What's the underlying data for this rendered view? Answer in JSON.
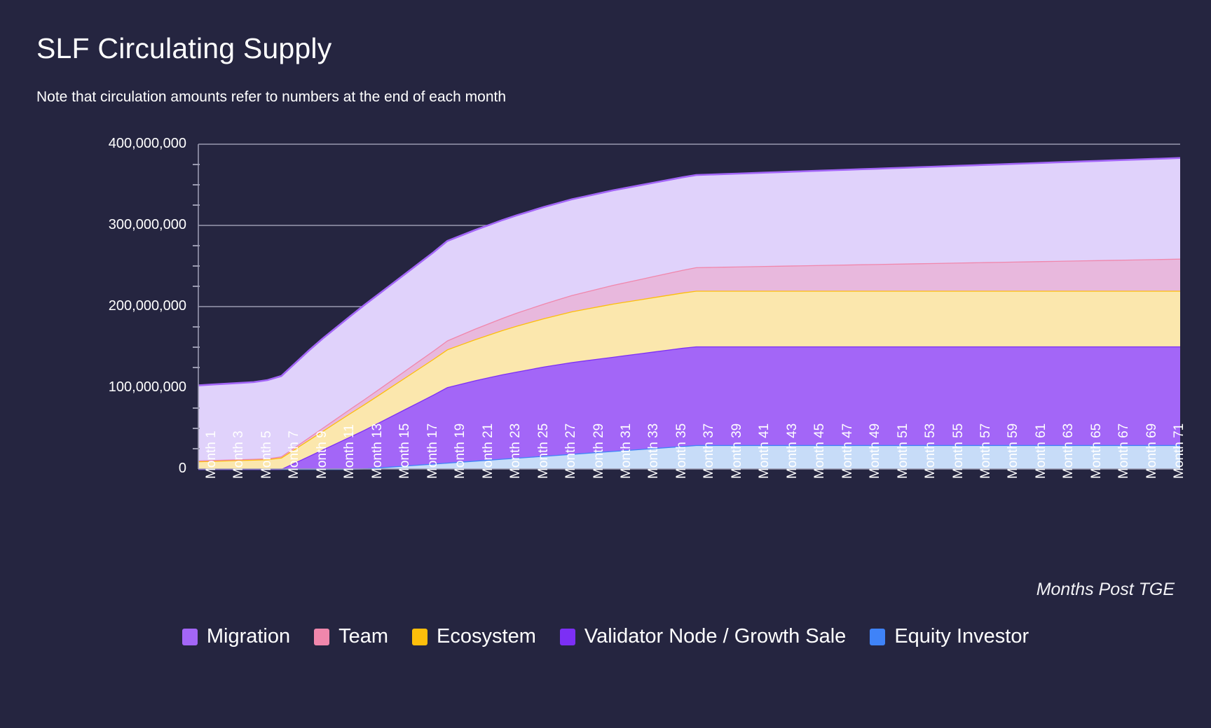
{
  "header": {
    "title": "SLF Circulating Supply",
    "subtitle": "Note that circulation amounts refer to numbers at the end of each month"
  },
  "axis": {
    "x_title": "Months Post TGE"
  },
  "legend": {
    "items": [
      {
        "label": "Migration",
        "color": "#a366f7"
      },
      {
        "label": "Team",
        "color": "#f087ac"
      },
      {
        "label": "Ecosystem",
        "color": "#fdbe0b"
      },
      {
        "label": "Validator Node / Growth Sale",
        "color": "#7c2ff5"
      },
      {
        "label": "Equity Investor",
        "color": "#3f83f8"
      }
    ]
  },
  "colors": {
    "background": "#252540",
    "grid": "#9a9ab0",
    "axis": "#9a9ab0",
    "text": "#ffffff",
    "fill_migration": "#e0d2fb",
    "fill_team": "#e8b8dd",
    "fill_ecosystem": "#fbe7ad",
    "fill_validator": "#a366f7",
    "fill_equity": "#c7dcf8",
    "line_migration": "#8c46f5",
    "line_team": "#ef6f91",
    "line_ecosystem": "#fbbf06",
    "line_validator": "#7c2ff5",
    "line_equity": "#3f83f8"
  },
  "chart_data": {
    "type": "area",
    "stacked": true,
    "title": "SLF Circulating Supply",
    "subtitle": "Note that circulation amounts refer to numbers at the end of each month",
    "xlabel": "Months Post TGE",
    "ylabel": "",
    "ylim": [
      0,
      400000000
    ],
    "ytick_values": [
      0,
      100000000,
      200000000,
      300000000,
      400000000
    ],
    "ytick_labels": [
      "0",
      "100,000,000",
      "200,000,000",
      "300,000,000",
      "400,000,000"
    ],
    "yminor_step": 25000000,
    "grid": true,
    "legend_position": "bottom",
    "x": [
      1,
      2,
      3,
      4,
      5,
      6,
      7,
      8,
      9,
      10,
      11,
      12,
      13,
      14,
      15,
      16,
      17,
      18,
      19,
      20,
      21,
      22,
      23,
      24,
      25,
      26,
      27,
      28,
      29,
      30,
      31,
      32,
      33,
      34,
      35,
      36,
      37,
      38,
      39,
      40,
      41,
      42,
      43,
      44,
      45,
      46,
      47,
      48,
      49,
      50,
      51,
      52,
      53,
      54,
      55,
      56,
      57,
      58,
      59,
      60,
      61,
      62,
      63,
      64,
      65,
      66,
      67,
      68,
      69,
      70,
      71,
      72
    ],
    "xtick_labels": [
      "Month 1",
      "Month 3",
      "Month 5",
      "Month 7",
      "Month 9",
      "Month 11",
      "Month 13",
      "Month 15",
      "Month 17",
      "Month 19",
      "Month 21",
      "Month 23",
      "Month 25",
      "Month 27",
      "Month 29",
      "Month 31",
      "Month 33",
      "Month 35",
      "Month 37",
      "Month 39",
      "Month 41",
      "Month 43",
      "Month 45",
      "Month 47",
      "Month 49",
      "Month 51",
      "Month 53",
      "Month 55",
      "Month 57",
      "Month 59",
      "Month 61",
      "Month 63",
      "Month 65",
      "Month 67",
      "Month 69",
      "Month 71"
    ],
    "stack_order_bottom_to_top": [
      "Equity Investor",
      "Validator Node / Growth Sale",
      "Ecosystem",
      "Team",
      "Migration"
    ],
    "series": [
      {
        "name": "Equity Investor",
        "color": "#3f83f8",
        "fill": "#c7dcf8",
        "values": [
          0,
          0,
          0,
          0,
          0,
          0,
          0,
          0,
          0,
          0,
          0,
          0,
          700000,
          1800000,
          3000000,
          4200000,
          5400000,
          6600000,
          7800000,
          9000000,
          10200000,
          11400000,
          12600000,
          13800000,
          15000000,
          16200000,
          17400000,
          18600000,
          19800000,
          21000000,
          22200000,
          23400000,
          24600000,
          25800000,
          27000000,
          28200000,
          29500000,
          29500000,
          29500000,
          29500000,
          29500000,
          29500000,
          29500000,
          29500000,
          29500000,
          29500000,
          29500000,
          29500000,
          29500000,
          29500000,
          29500000,
          29500000,
          29500000,
          29500000,
          29500000,
          29500000,
          29500000,
          29500000,
          29500000,
          29500000,
          29500000,
          29500000,
          29500000,
          29500000,
          29500000,
          29500000,
          29500000,
          29500000,
          29500000,
          29500000,
          29500000,
          29500000
        ]
      },
      {
        "name": "Validator Node / Growth Sale",
        "color": "#7c2ff5",
        "fill": "#a366f7",
        "values": [
          0,
          0,
          0,
          0,
          0,
          0,
          0,
          8000000,
          16000000,
          24000000,
          32000000,
          40000000,
          47500000,
          55000000,
          62500000,
          70000000,
          77500000,
          85000000,
          93000000,
          96000000,
          99000000,
          101500000,
          104000000,
          106000000,
          108000000,
          110000000,
          111500000,
          113000000,
          114000000,
          115000000,
          116000000,
          117000000,
          118000000,
          119000000,
          120000000,
          121000000,
          121500000,
          121500000,
          121500000,
          121500000,
          121500000,
          121500000,
          121500000,
          121500000,
          121500000,
          121500000,
          121500000,
          121500000,
          121500000,
          121500000,
          121500000,
          121500000,
          121500000,
          121500000,
          121500000,
          121500000,
          121500000,
          121500000,
          121500000,
          121500000,
          121500000,
          121500000,
          121500000,
          121500000,
          121500000,
          121500000,
          121500000,
          121500000,
          121500000,
          121500000,
          121500000,
          121500000
        ]
      },
      {
        "name": "Ecosystem",
        "color": "#fdbe0b",
        "fill": "#fbe7ad",
        "values": [
          9500000,
          10000000,
          10500000,
          11000000,
          11500000,
          12000000,
          14000000,
          17000000,
          20000000,
          23000000,
          26000000,
          29000000,
          31500000,
          34000000,
          36500000,
          39000000,
          41500000,
          44000000,
          46500000,
          48500000,
          50500000,
          52500000,
          54500000,
          56500000,
          58000000,
          59500000,
          61000000,
          62500000,
          63500000,
          64500000,
          65500000,
          66000000,
          66500000,
          67000000,
          67500000,
          68000000,
          68500000,
          68500000,
          68500000,
          68500000,
          68500000,
          68500000,
          68500000,
          68500000,
          68500000,
          68500000,
          68500000,
          68500000,
          68500000,
          68500000,
          68500000,
          68500000,
          68500000,
          68500000,
          68500000,
          68500000,
          68500000,
          68500000,
          68500000,
          68500000,
          68500000,
          68500000,
          68500000,
          68500000,
          68500000,
          68500000,
          68500000,
          68500000,
          68500000,
          68500000,
          68500000,
          68500000
        ]
      },
      {
        "name": "Team",
        "color": "#f087ac",
        "fill": "#e8b8dd",
        "values": [
          1000000,
          1000000,
          1000000,
          1000000,
          1000000,
          1000000,
          1500000,
          2200000,
          3000000,
          3800000,
          4600000,
          5400000,
          6200000,
          7000000,
          7800000,
          8600000,
          9400000,
          10200000,
          11000000,
          12000000,
          13000000,
          14000000,
          15000000,
          16000000,
          17000000,
          18000000,
          19000000,
          20000000,
          21000000,
          22000000,
          23000000,
          24000000,
          25000000,
          26000000,
          27000000,
          28000000,
          29000000,
          29300000,
          29600000,
          29900000,
          30200000,
          30500000,
          30800000,
          31100000,
          31400000,
          31700000,
          32000000,
          32300000,
          32600000,
          32900000,
          33200000,
          33500000,
          33800000,
          34100000,
          34400000,
          34700000,
          35000000,
          35300000,
          35600000,
          35900000,
          36200000,
          36500000,
          36800000,
          37100000,
          37400000,
          37700000,
          38000000,
          38300000,
          38600000,
          38900000,
          39200000,
          39500000
        ]
      },
      {
        "name": "Migration",
        "color": "#a366f7",
        "fill": "#e0d2fb",
        "values": [
          92500000,
          93000000,
          93500000,
          94000000,
          94500000,
          96500000,
          99000000,
          103000000,
          107000000,
          110000000,
          112000000,
          114000000,
          116000000,
          117000000,
          118000000,
          119000000,
          120000000,
          121000000,
          122500000,
          122000000,
          121500000,
          121000000,
          120500000,
          120000000,
          119500000,
          119000000,
          118500000,
          118000000,
          117500000,
          117000000,
          116500000,
          116000000,
          115500000,
          115000000,
          114500000,
          114000000,
          113500000,
          113800000,
          114100000,
          114400000,
          114700000,
          115000000,
          115300000,
          115600000,
          115900000,
          116200000,
          116500000,
          116800000,
          117100000,
          117400000,
          117700000,
          118000000,
          118300000,
          118600000,
          118900000,
          119200000,
          119500000,
          119800000,
          120100000,
          120400000,
          120700000,
          121000000,
          121300000,
          121600000,
          121900000,
          122200000,
          122500000,
          122800000,
          123100000,
          123400000,
          123700000,
          124000000
        ]
      }
    ]
  }
}
